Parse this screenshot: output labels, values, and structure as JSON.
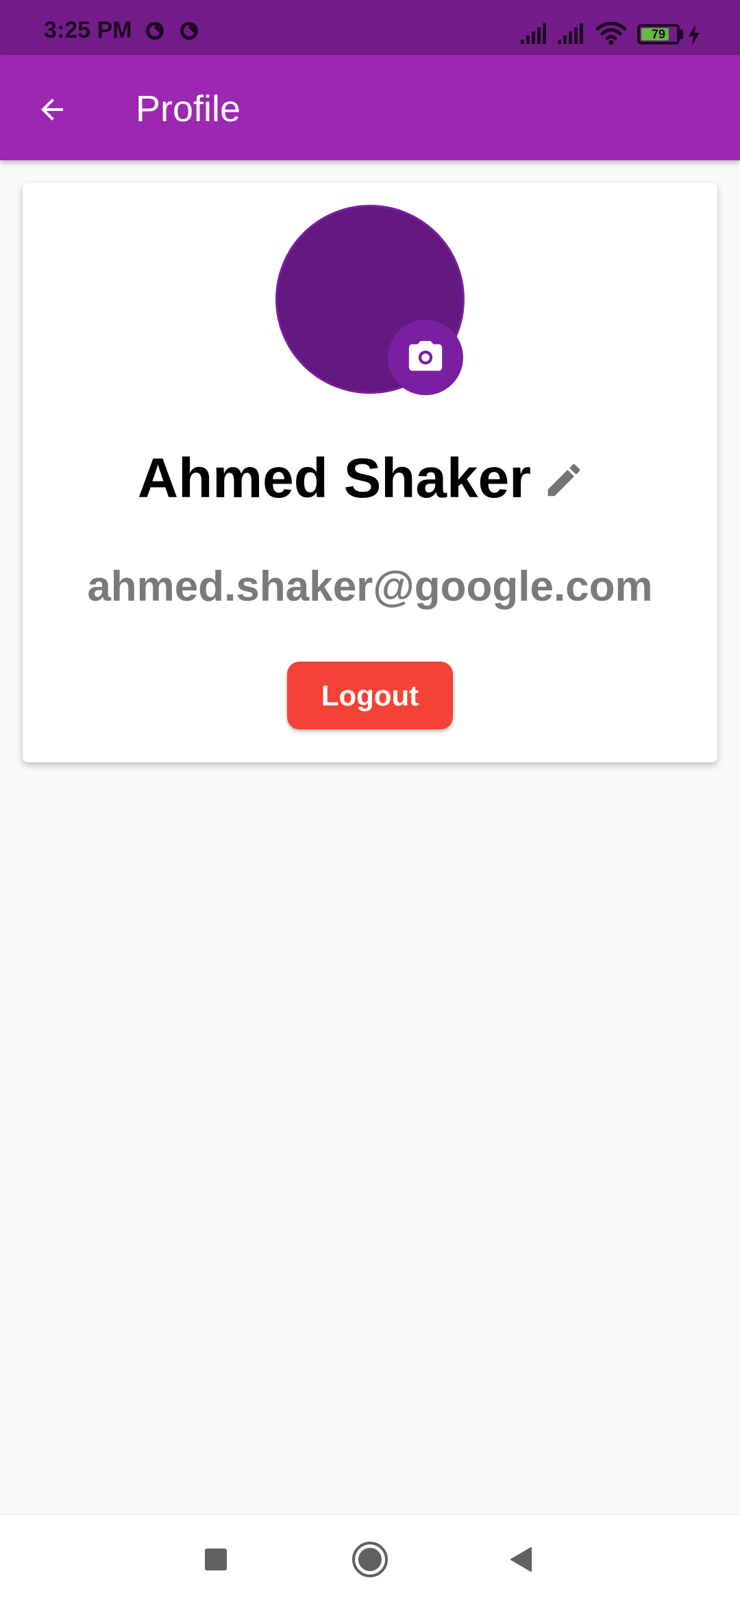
{
  "status_bar": {
    "time": "3:25 PM",
    "battery_level": "79",
    "battery_fraction": 0.79,
    "icons": [
      "do-not-disturb-icon",
      "do-not-disturb-icon",
      "signal-icon",
      "signal-icon",
      "wifi-icon",
      "battery-icon",
      "charging-icon"
    ]
  },
  "app_bar": {
    "title": "Profile",
    "back_icon": "arrow-back-icon"
  },
  "profile": {
    "name": "Ahmed Shaker",
    "email": "ahmed.shaker@google.com",
    "logout_label": "Logout",
    "camera_icon": "camera-icon",
    "edit_icon": "pencil-icon"
  },
  "nav_bar": {
    "icons": [
      "recents-square-icon",
      "home-circle-icon",
      "back-triangle-icon"
    ]
  },
  "colors": {
    "status_bar": "#741c89",
    "app_bar": "#9c27b0",
    "avatar": "#63197f",
    "avatar_border": "#7b1fa2",
    "logout": "#f44336",
    "email_text": "#7a7a7a",
    "background": "#fafafa"
  }
}
